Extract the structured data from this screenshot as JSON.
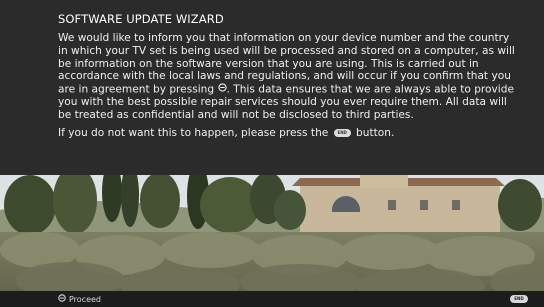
{
  "dialog": {
    "title": "SOFTWARE UPDATE WIZARD",
    "message_part1": "We would like to inform you that information on your device number and the country in which your TV set is being used will be processed and stored on a computer, as will be information on the software version that you are using. This is carried out in accordance with the local laws and regulations, and will occur if you confirm that you are in agreement by pressing",
    "message_part2": ". This data ensures that we are always able to provide you with the best possible repair services should you ever require them. All data will be treated as confidential and will not be disclosed to third parties.",
    "decline_part1": "If you do not want this to happen, please press the",
    "decline_part2": "button.",
    "confirm_icon": "ok-button-icon",
    "end_icon": "end-button-icon",
    "end_label": "END"
  },
  "footer": {
    "proceed_icon": "ok-button-icon",
    "proceed_label": "Proceed",
    "end_label": "END"
  },
  "colors": {
    "dialog_bg": "#2b2b2b",
    "text": "#f0f0f0",
    "footer_bg": "#1c1c1c"
  }
}
